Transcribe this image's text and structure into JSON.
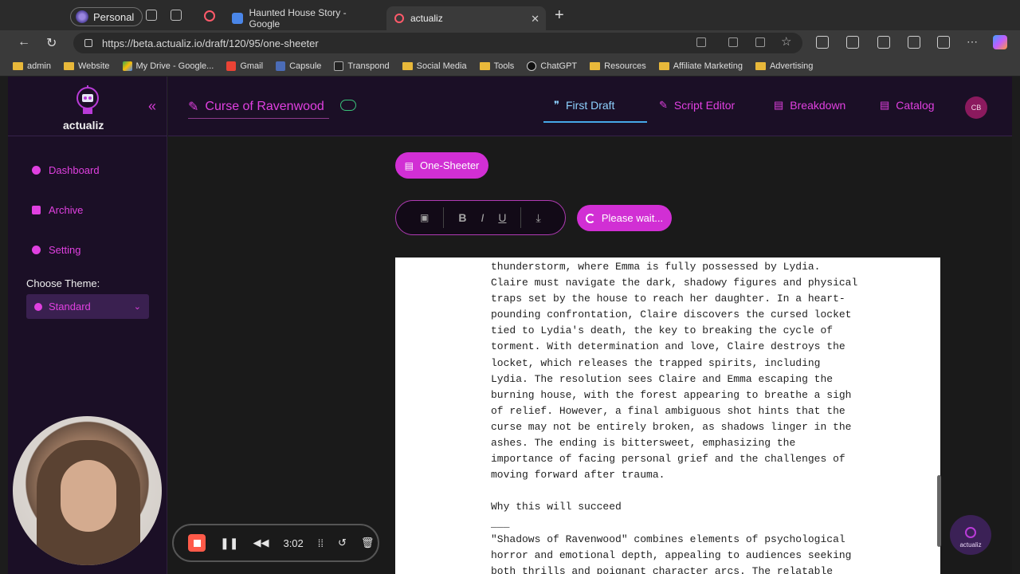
{
  "browser": {
    "profile": "Personal",
    "tabs": [
      {
        "title": "Haunted House Story - Google"
      },
      {
        "title": "actualiz"
      }
    ],
    "url": "https://beta.actualiz.io/draft/120/95/one-sheeter",
    "bookmarks": [
      "admin",
      "Website",
      "My Drive - Google...",
      "Gmail",
      "Capsule",
      "Transpond",
      "Social Media",
      "Tools",
      "ChatGPT",
      "Resources",
      "Affiliate Marketing",
      "Advertising"
    ]
  },
  "sidebar": {
    "logo": "actualiz",
    "items": [
      {
        "label": "Dashboard"
      },
      {
        "label": "Archive"
      },
      {
        "label": "Setting"
      }
    ],
    "theme_label": "Choose Theme:",
    "theme_value": "Standard"
  },
  "header": {
    "project_title": "Curse of Ravenwood",
    "nav": [
      {
        "label": "First Draft",
        "active": true
      },
      {
        "label": "Script Editor"
      },
      {
        "label": "Breakdown"
      },
      {
        "label": "Catalog"
      }
    ],
    "avatar": "CB"
  },
  "main": {
    "one_sheeter_button": "One-Sheeter",
    "wait_button": "Please wait...",
    "toolbar": [
      "B",
      "I",
      "U"
    ],
    "document_lines": [
      "thunderstorm, where Emma is fully possessed by Lydia.",
      "Claire must navigate the dark, shadowy figures and physical",
      "traps set by the house to reach her daughter. In a heart-",
      "pounding confrontation, Claire discovers the cursed locket",
      "tied to Lydia's death, the key to breaking the cycle of",
      "torment. With determination and love, Claire destroys the",
      "locket, which releases the trapped spirits, including",
      "Lydia. The resolution sees Claire and Emma escaping the",
      "burning house, with the forest appearing to breathe a sigh",
      "of relief. However, a final ambiguous shot hints that the",
      "curse may not be entirely broken, as shadows linger in the",
      "ashes. The ending is bittersweet, emphasizing the",
      "importance of facing personal grief and the challenges of",
      "moving forward after trauma.",
      "",
      "Why this will succeed",
      "___",
      "\"Shadows of Ravenwood\" combines elements of psychological",
      "horror and emotional depth, appealing to audiences seeking",
      "both thrills and poignant character arcs. The relatable"
    ],
    "chat_label": "actualiz"
  },
  "recorder": {
    "time": "3:02"
  },
  "colors": {
    "accent": "#d12fd4",
    "active_nav": "#8ed2ff",
    "sidebar_bg": "#1b0f26"
  }
}
